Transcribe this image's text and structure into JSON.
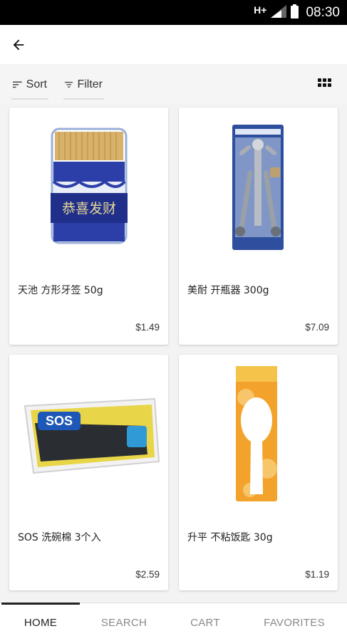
{
  "status_bar": {
    "network": "H+",
    "time": "08:30"
  },
  "app_bar": {
    "back_icon": "arrow-back-icon"
  },
  "toolbar": {
    "sort_label": "Sort",
    "filter_label": "Filter",
    "sort_icon": "sort-icon",
    "filter_icon": "filter-icon",
    "view_icon": "grid-view-icon"
  },
  "products": [
    {
      "name": "天池 方形牙签 50g",
      "price": "$1.49",
      "image": "toothpick-jar-image",
      "image_text": "恭喜发财"
    },
    {
      "name": "美耐 开瓶器 300g",
      "price": "$7.09",
      "image": "corkscrew-package-image"
    },
    {
      "name": "SOS 洗碗棉 3个入",
      "price": "$2.59",
      "image": "sos-scouring-pads-image",
      "image_text": "SOS"
    },
    {
      "name": "升平 不粘饭匙 30g",
      "price": "$1.19",
      "image": "rice-paddle-package-image"
    }
  ],
  "bottom_nav": {
    "items": [
      {
        "label": "HOME",
        "active": true
      },
      {
        "label": "SEARCH",
        "active": false
      },
      {
        "label": "CART",
        "active": false
      },
      {
        "label": "FAVORITES",
        "active": false
      }
    ]
  },
  "colors": {
    "status_bar_bg": "#000000",
    "page_bg": "#f3f3f3",
    "card_bg": "#ffffff",
    "active_nav": "#222222",
    "inactive_nav": "#8a8a8a"
  }
}
